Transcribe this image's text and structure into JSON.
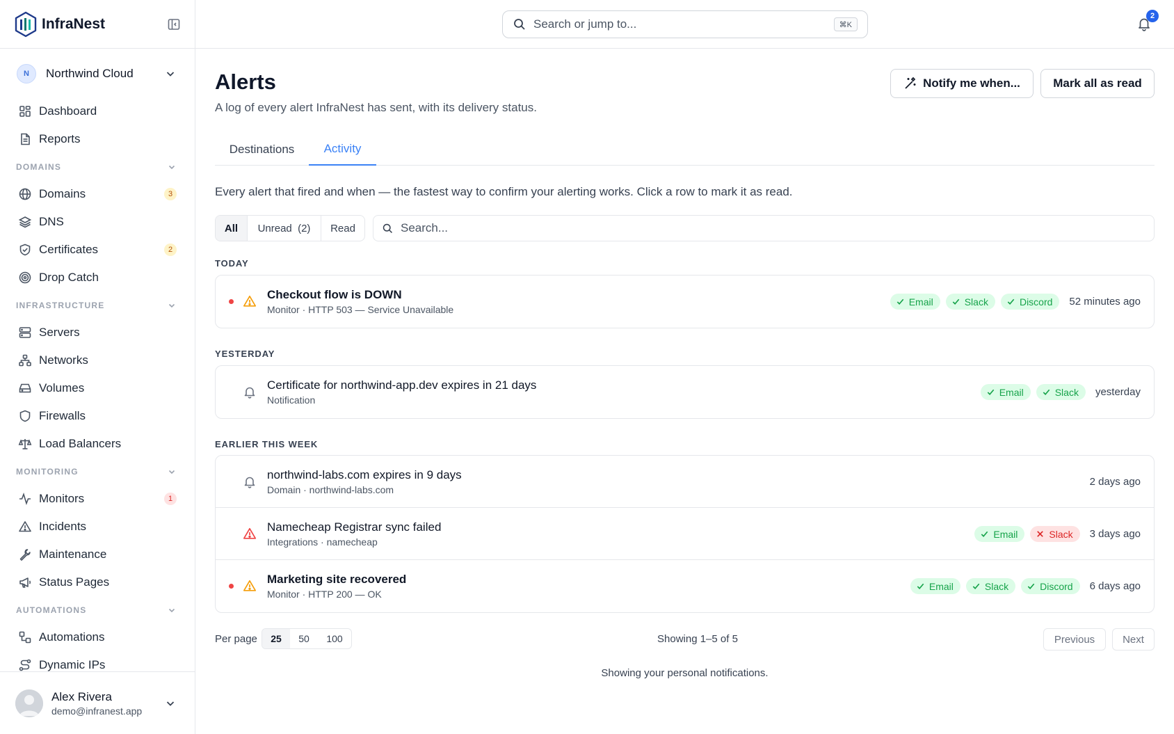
{
  "brand": {
    "name": "InfraNest"
  },
  "workspace": {
    "initial": "N",
    "name": "Northwind Cloud"
  },
  "nav": {
    "top": [
      {
        "label": "Dashboard",
        "icon": "dashboard-icon"
      },
      {
        "label": "Reports",
        "icon": "document-icon"
      }
    ],
    "sections": [
      {
        "title": "DOMAINS",
        "items": [
          {
            "label": "Domains",
            "icon": "globe-icon",
            "badge": "3"
          },
          {
            "label": "DNS",
            "icon": "layers-icon"
          },
          {
            "label": "Certificates",
            "icon": "shield-check-icon",
            "badge": "2"
          },
          {
            "label": "Drop Catch",
            "icon": "target-icon"
          }
        ]
      },
      {
        "title": "INFRASTRUCTURE",
        "items": [
          {
            "label": "Servers",
            "icon": "server-icon"
          },
          {
            "label": "Networks",
            "icon": "network-icon"
          },
          {
            "label": "Volumes",
            "icon": "hard-drive-icon"
          },
          {
            "label": "Firewalls",
            "icon": "shield-icon"
          },
          {
            "label": "Load Balancers",
            "icon": "scale-icon"
          }
        ]
      },
      {
        "title": "MONITORING",
        "items": [
          {
            "label": "Monitors",
            "icon": "activity-icon",
            "badge": "1"
          },
          {
            "label": "Incidents",
            "icon": "warning-icon"
          },
          {
            "label": "Maintenance",
            "icon": "wrench-icon"
          },
          {
            "label": "Status Pages",
            "icon": "megaphone-icon"
          }
        ]
      },
      {
        "title": "AUTOMATIONS",
        "items": [
          {
            "label": "Automations",
            "icon": "workflow-icon"
          },
          {
            "label": "Dynamic IPs",
            "icon": "route-icon"
          }
        ]
      }
    ]
  },
  "user": {
    "name": "Alex Rivera",
    "email": "demo@infranest.app"
  },
  "topbar": {
    "search_placeholder": "Search or jump to...",
    "shortcut": "⌘K",
    "notif_count": "2"
  },
  "page": {
    "title": "Alerts",
    "subtitle": "A log of every alert InfraNest has sent, with its delivery status.",
    "notify_label": "Notify me when...",
    "mark_label": "Mark all as read",
    "tabs": [
      {
        "label": "Destinations"
      },
      {
        "label": "Activity"
      }
    ],
    "intro": "Every alert that fired and when — the fastest way to confirm your alerting works. Click a row to mark it as read.",
    "filters": {
      "all": "All",
      "unread": "Unread  (2)",
      "read": "Read"
    },
    "list_search_placeholder": "Search..."
  },
  "groups": [
    {
      "label": "TODAY",
      "rows": [
        {
          "title": "Checkout flow is DOWN",
          "meta": "Monitor · HTTP 503 — Service Unavailable",
          "unread": true,
          "icon": "warning-icon",
          "icon_color": "#f59e0b",
          "bold": true,
          "channels": [
            {
              "name": "Email",
              "ok": true
            },
            {
              "name": "Slack",
              "ok": true
            },
            {
              "name": "Discord",
              "ok": true
            }
          ],
          "time": "52 minutes ago"
        }
      ]
    },
    {
      "label": "YESTERDAY",
      "rows": [
        {
          "title": "Certificate for northwind-app.dev expires in 21 days",
          "meta": "Notification",
          "unread": false,
          "icon": "bell-icon",
          "icon_color": "#6b7280",
          "bold": false,
          "channels": [
            {
              "name": "Email",
              "ok": true
            },
            {
              "name": "Slack",
              "ok": true
            }
          ],
          "time": "yesterday"
        }
      ]
    },
    {
      "label": "EARLIER THIS WEEK",
      "rows": [
        {
          "title": "northwind-labs.com expires in 9 days",
          "meta": "Domain · northwind-labs.com",
          "unread": false,
          "icon": "bell-icon",
          "icon_color": "#6b7280",
          "bold": false,
          "channels": [],
          "time": "2 days ago"
        },
        {
          "title": "Namecheap Registrar sync failed",
          "meta": "Integrations · namecheap",
          "unread": false,
          "icon": "warning-icon",
          "icon_color": "#ef4444",
          "bold": false,
          "channels": [
            {
              "name": "Email",
              "ok": true
            },
            {
              "name": "Slack",
              "ok": false
            }
          ],
          "time": "3 days ago"
        },
        {
          "title": "Marketing site recovered",
          "meta": "Monitor · HTTP 200 — OK",
          "unread": true,
          "icon": "warning-icon",
          "icon_color": "#f59e0b",
          "bold": true,
          "channels": [
            {
              "name": "Email",
              "ok": true
            },
            {
              "name": "Slack",
              "ok": true
            },
            {
              "name": "Discord",
              "ok": true
            }
          ],
          "time": "6 days ago"
        }
      ]
    }
  ],
  "pagination": {
    "per_page_label": "Per page",
    "options": [
      "25",
      "50",
      "100"
    ],
    "showing": "Showing 1–5 of 5",
    "prev": "Previous",
    "next": "Next"
  },
  "footer_note": "Showing your personal notifications."
}
